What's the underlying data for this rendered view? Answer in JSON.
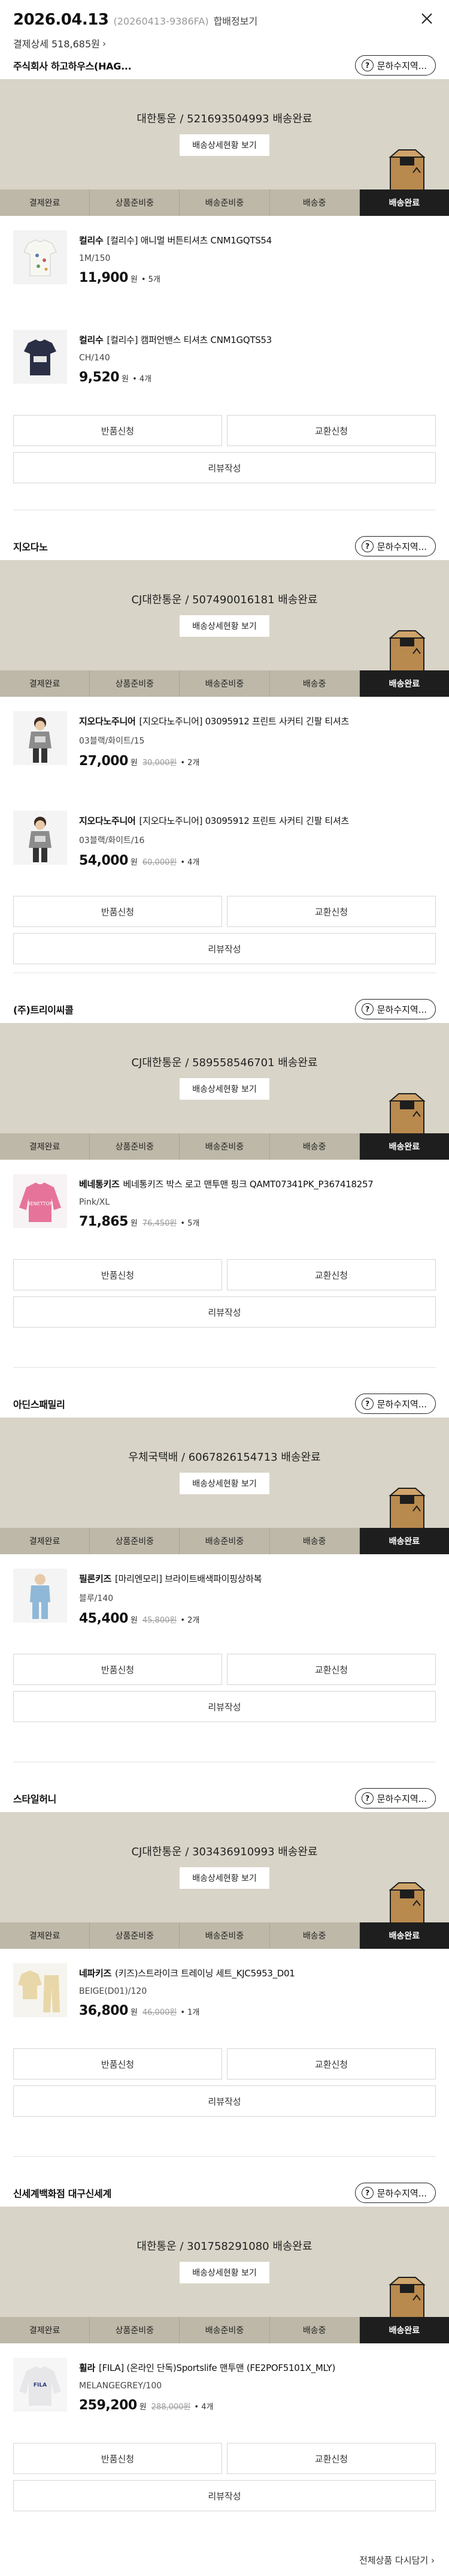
{
  "header": {
    "date": "2026.04.13",
    "order_no": "(20260413-9386FA)",
    "detail_link": "합배정보기",
    "payment_label": "결제상세 518,685원",
    "close_icon": "close-icon"
  },
  "common": {
    "contact_label": "문하수지역...",
    "delivery_detail_button": "배송상세현황 보기",
    "steps": [
      "결제완료",
      "상품준비중",
      "배송준비중",
      "배송중",
      "배송완료"
    ],
    "return_label": "반품신청",
    "exchange_label": "교환신청",
    "review_label": "리뷰작성",
    "won": "원"
  },
  "shops": [
    {
      "name": "주식회사 하고하우스(HAG...",
      "delivery_text": "대한통운 / 521693504993 배송완료",
      "items": [
        {
          "brand": "컬리수",
          "title": "[컬리수] 애니멀 버튼티셔츠 CNM1GQTS54",
          "option": "1M/150",
          "price": "11,900",
          "orig": "",
          "qty": "• 5개"
        },
        {
          "brand": "컬리수",
          "title": "[컬리수] 캠퍼언밴스 티셔츠 CNM1GQTS53",
          "option": "CH/140",
          "price": "9,520",
          "orig": "",
          "qty": "• 4개"
        }
      ]
    },
    {
      "name": "지오다노",
      "delivery_text": "CJ대한통운 / 507490016181 배송완료",
      "items": [
        {
          "brand": "지오다노주니어",
          "title": "[지오다노주니어] 03095912 프린트 사커티 긴팔 티셔츠",
          "option": "03블랙/화이트/15",
          "price": "27,000",
          "orig": "30,000원",
          "qty": "• 2개"
        },
        {
          "brand": "지오다노주니어",
          "title": "[지오다노주니어] 03095912 프린트 사커티 긴팔 티셔츠",
          "option": "03블랙/화이트/16",
          "price": "54,000",
          "orig": "60,000원",
          "qty": "• 4개"
        }
      ]
    },
    {
      "name": "(주)트리이씨콜",
      "delivery_text": "CJ대한통운 / 589558546701 배송완료",
      "items": [
        {
          "brand": "베네통키즈",
          "title": "베네통키즈 박스 로고 맨투맨 핑크 QAMT07341PK_P367418257",
          "option": "Pink/XL",
          "price": "71,865",
          "orig": "76,450원",
          "qty": "• 5개"
        }
      ]
    },
    {
      "name": "아딘스패밀리",
      "delivery_text": "우체국택배 / 6067826154713 배송완료",
      "items": [
        {
          "brand": "필론키즈",
          "title": "[마리엔모리] 브라이트배색파이핑상하복",
          "option": "블루/140",
          "price": "45,400",
          "orig": "45,800원",
          "qty": "• 2개"
        }
      ]
    },
    {
      "name": "스타일허니",
      "delivery_text": "CJ대한통운 / 303436910993 배송완료",
      "items": [
        {
          "brand": "네파키즈",
          "title": "(키즈)스트라이크 트레이닝 세트_KJC5953_D01",
          "option": "BEIGE(D01)/120",
          "price": "36,800",
          "orig": "46,000원",
          "qty": "• 1개"
        }
      ]
    },
    {
      "name": "신세계백화점 대구신세계",
      "delivery_text": "대한통운 / 301758291080 배송완료",
      "items": [
        {
          "brand": "휠라",
          "title": "[FILA] (온라인 단독)Sportslife 맨투맨 (FE2POF5101X_MLY)",
          "option": "MELANGEGREY/100",
          "price": "259,200",
          "orig": "288,000원",
          "qty": "• 4개"
        }
      ]
    }
  ],
  "footer": {
    "more_link": "전체상품 다시담기 ›"
  }
}
